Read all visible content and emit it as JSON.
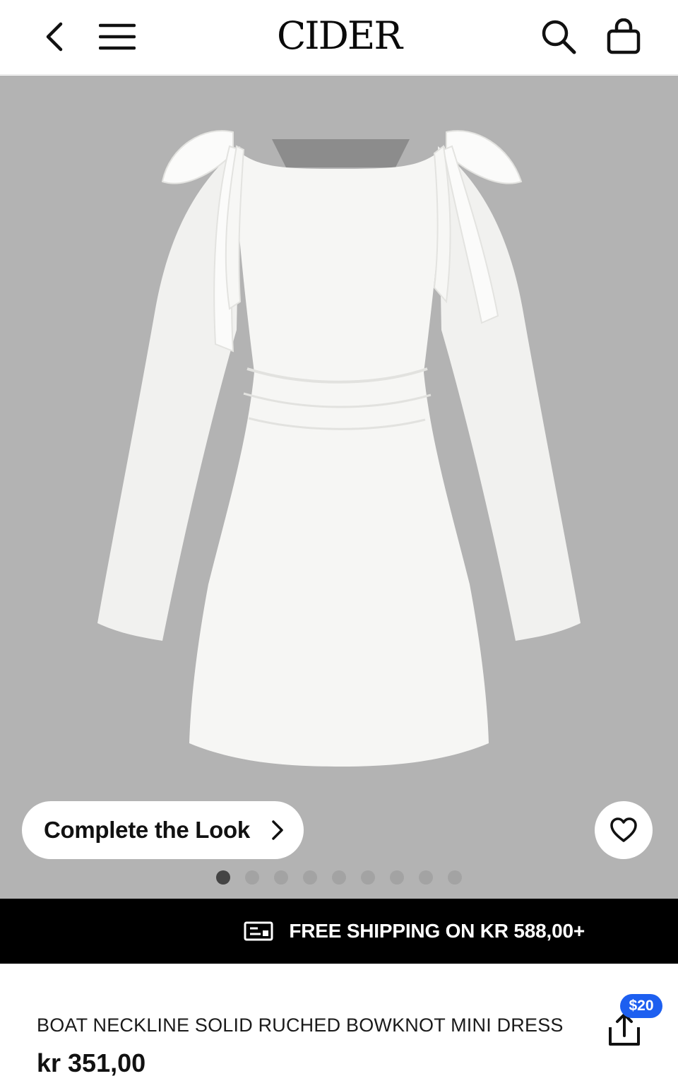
{
  "header": {
    "logo": "CIDER",
    "icons": [
      "back-chevron-icon",
      "hamburger-menu-icon",
      "search-icon",
      "shopping-bag-icon"
    ]
  },
  "product": {
    "image_alt": "white dress image",
    "complete_look_label": "Complete the Look",
    "gallery": {
      "total_images": 9,
      "active_index": 0
    },
    "title": "BOAT NECKLINE SOLID RUCHED BOWKNOT MINI DRESS",
    "price": "kr 351,00",
    "share_badge": "$20"
  },
  "banner": {
    "text": "FREE SHIPPING ON KR 588,00+"
  },
  "colors": {
    "hero_background": "#b3b3b3",
    "banner_background": "#000000",
    "badge_blue": "#1d5ff0"
  }
}
